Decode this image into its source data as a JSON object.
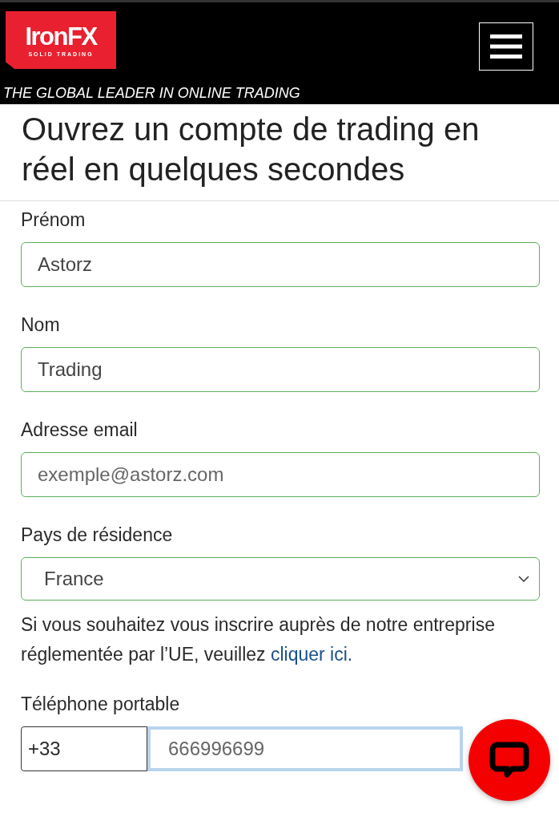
{
  "header": {
    "logo": {
      "name": "IronFX",
      "tagline": "SOLID TRADING"
    },
    "slogan": "THE GLOBAL LEADER IN ONLINE TRADING"
  },
  "title": "Ouvrez un compte de trading en réel en quelques secondes",
  "fields": [
    {
      "kind": "text",
      "label": "Prénom",
      "value": "Astorz"
    },
    {
      "kind": "text",
      "label": "Nom",
      "value": "Trading"
    },
    {
      "kind": "text",
      "label": "Adresse email",
      "placeholder": "exemple@astorz.com"
    },
    {
      "kind": "select",
      "label": "Pays de résidence",
      "value": "France"
    }
  ],
  "notice": {
    "text": "Si vous souhaitez vous inscrire auprès de notre entreprise réglementée par l’UE, veuillez",
    "link": "cliquer ici."
  },
  "phone": {
    "label": "Téléphone portable",
    "code": "+33",
    "placeholder": "666996699",
    "focused": true
  }
}
